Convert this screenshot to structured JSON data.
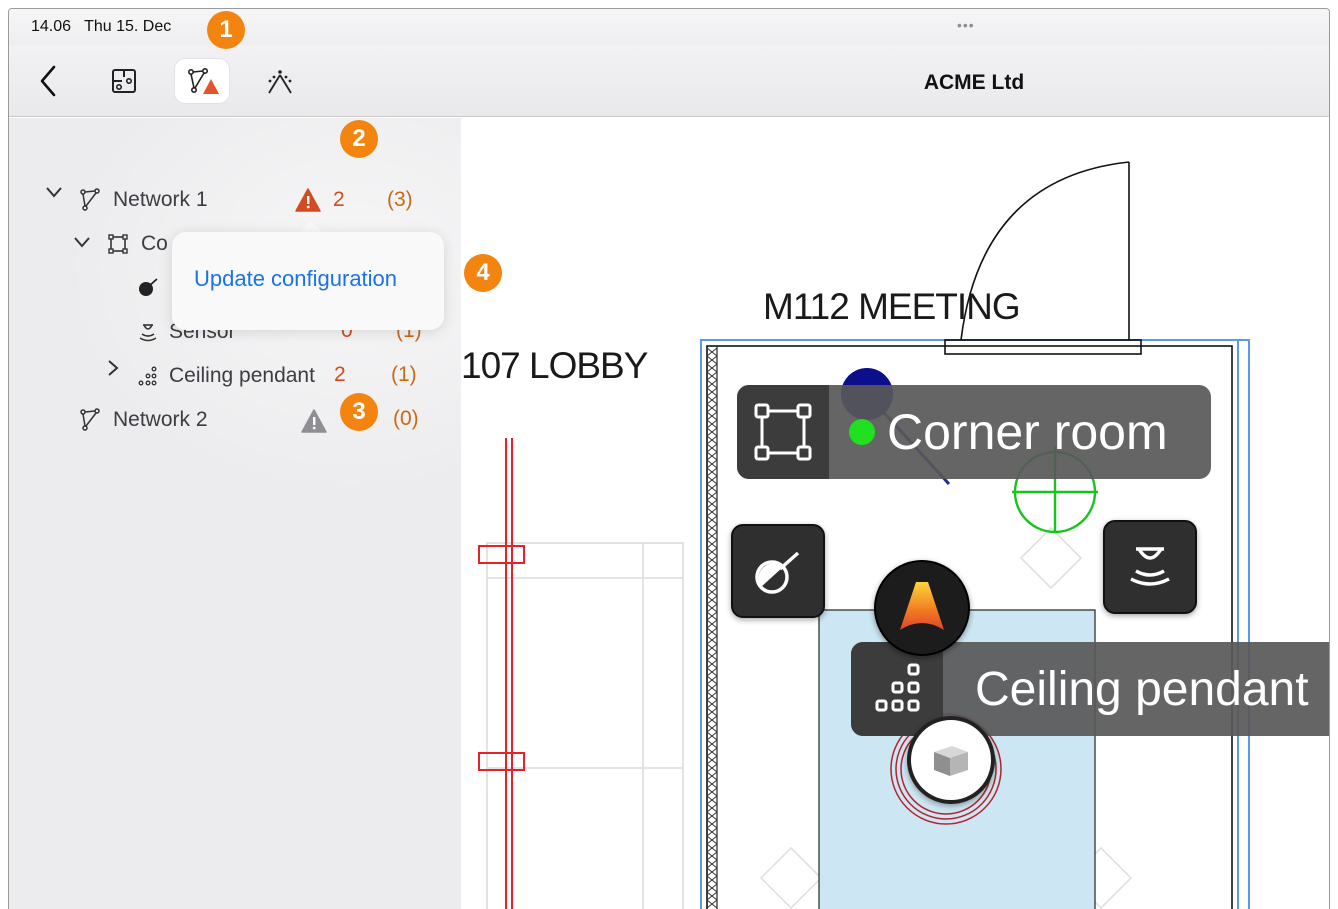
{
  "status": {
    "time": "14.06",
    "date": "Thu 15. Dec",
    "dots": "•••"
  },
  "navbar": {
    "title": "ACME Ltd",
    "buttons": [
      {
        "icon": "back-chevron-icon"
      },
      {
        "icon": "floorplan-icon"
      },
      {
        "icon": "network-warning-icon",
        "active": true
      },
      {
        "icon": "beacon-icon"
      }
    ]
  },
  "tree": {
    "network1": {
      "label": "Network 1",
      "warning_count": "2",
      "count": "(3)"
    },
    "corner_room": {
      "label": "Co"
    },
    "sensor": {
      "label": "Sensor",
      "warning_count": "0",
      "count": "(1)"
    },
    "ceiling_pendant": {
      "label": "Ceiling pendant",
      "warning_count": "2",
      "count": "(1)"
    },
    "network2": {
      "label": "Network 2",
      "count": "(0)"
    }
  },
  "popover": {
    "action": "Update configuration"
  },
  "badges": {
    "b1": "1",
    "b2": "2",
    "b3": "3",
    "b4": "4"
  },
  "plan": {
    "room_meeting": "M112 MEETING",
    "room_lobby": "107 LOBBY",
    "corner_room_card": "Corner room",
    "ceiling_pendant_card": "Ceiling pendant"
  },
  "colors": {
    "accent": "#1a73e8",
    "badge": "#f2840f",
    "warning": "#d34b22",
    "count": "#c66a18"
  }
}
